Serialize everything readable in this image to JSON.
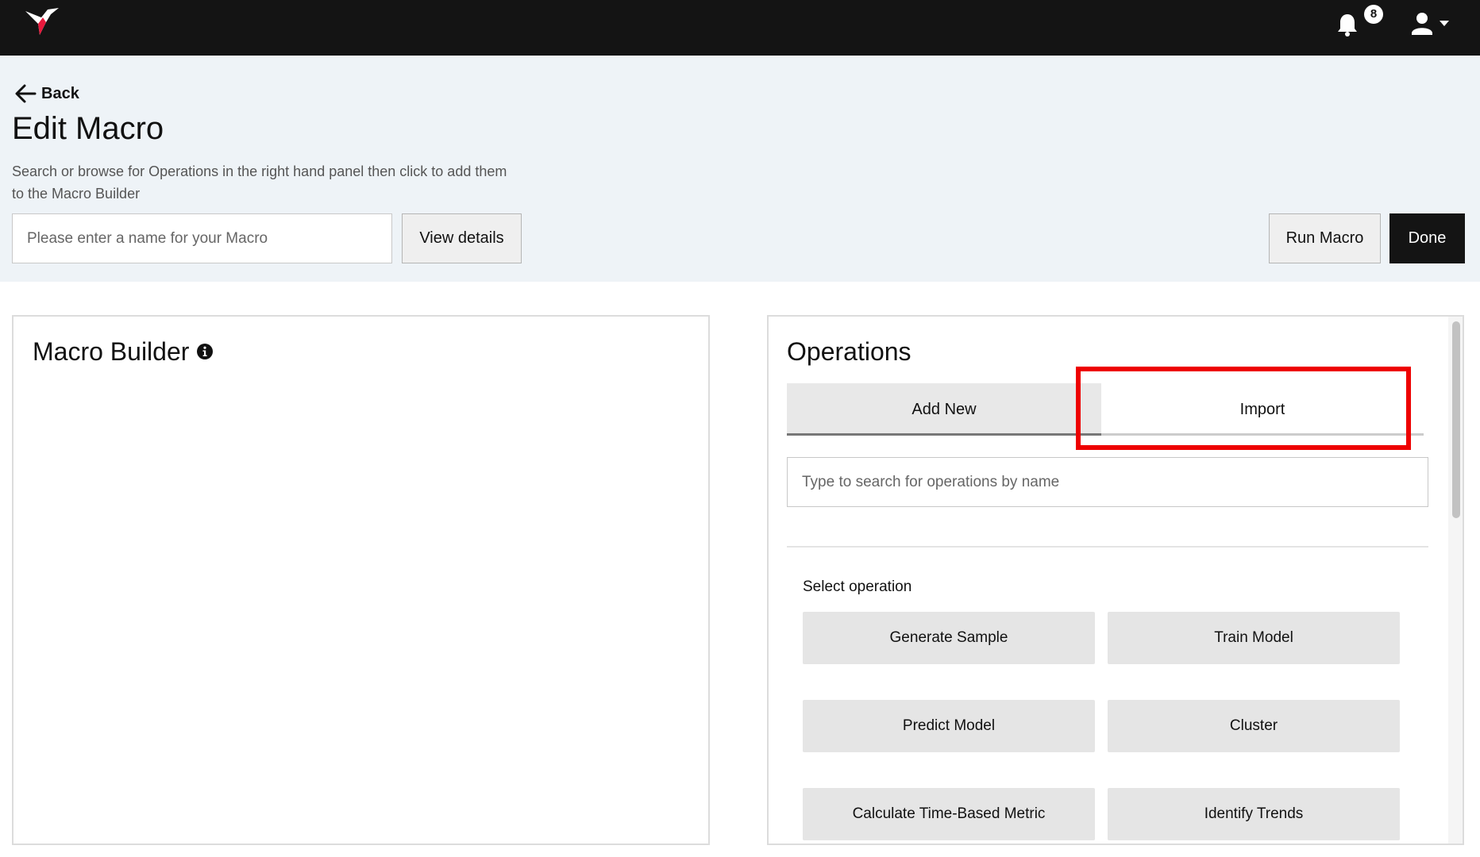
{
  "nav": {
    "notification_count": "8"
  },
  "header": {
    "back_label": "Back",
    "title": "Edit Macro",
    "subtitle": "Search or browse for Operations in the right hand panel then click to add them to the Macro Builder",
    "name_placeholder": "Please enter a name for your Macro",
    "name_value": "",
    "view_details_label": "View details",
    "run_macro_label": "Run Macro",
    "done_label": "Done"
  },
  "macro_builder": {
    "title": "Macro Builder"
  },
  "operations": {
    "title": "Operations",
    "tabs": [
      {
        "label": "Add New",
        "selected": true
      },
      {
        "label": "Import",
        "selected": false
      }
    ],
    "search_placeholder": "Type to search for operations by name",
    "search_value": "",
    "select_label": "Select operation",
    "items": [
      "Generate Sample",
      "Train Model",
      "Predict Model",
      "Cluster",
      "Calculate Time-Based Metric",
      "Identify Trends"
    ]
  },
  "colors": {
    "topbar": "#141414",
    "header_bg": "#eef3f7",
    "highlight": "#ee0000",
    "logo_accent": "#e8193c"
  },
  "icons": [
    "bird-logo-icon",
    "bell-icon",
    "user-icon",
    "caret-down-icon",
    "arrow-left-icon",
    "info-icon"
  ]
}
